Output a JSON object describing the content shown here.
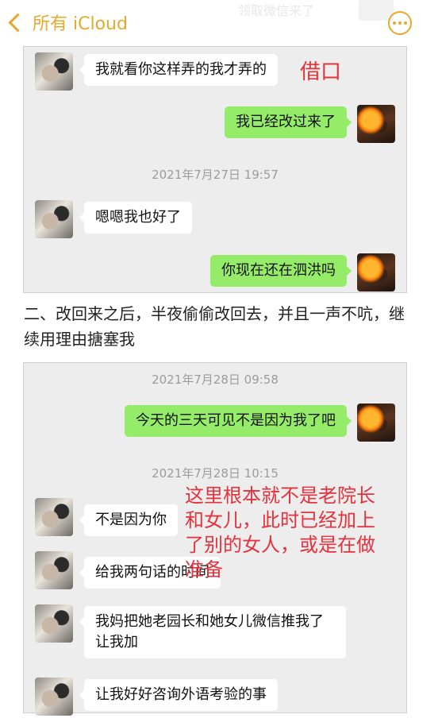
{
  "nav": {
    "back_label": "所有 iCloud",
    "ghost_text": "领取微信来了"
  },
  "panel1": {
    "msg1": "我就看你这样弄的我才弄的",
    "note": "借口",
    "msg2": "我已经改过来了",
    "time1": "2021年7月27日 19:57",
    "msg3": "嗯嗯我也好了",
    "msg4": "你现在还在泗洪吗"
  },
  "caption": "二、改回来之后，半夜偷偷改回去，并且一声不吭，继续用理由搪塞我",
  "panel2": {
    "time1": "2021年7月28日 09:58",
    "msg1": "今天的三天可见不是因为我了吧",
    "time2": "2021年7月28日 10:15",
    "msg2": "不是因为你",
    "msg3": "给我两句话的时间",
    "msg4": "我妈把她老园长和她女儿微信推我了让我加",
    "msg5": "让我好好咨询外语考验的事",
    "note": "这里根本就不是老院长和女儿，此时已经加上了别的女人，或是在做准备"
  },
  "colors": {
    "accent": "#e7a92b",
    "bubble_green": "#95ec69",
    "note_red": "#e5323c"
  },
  "icons": [
    "chevron-left-icon",
    "more-icon"
  ]
}
